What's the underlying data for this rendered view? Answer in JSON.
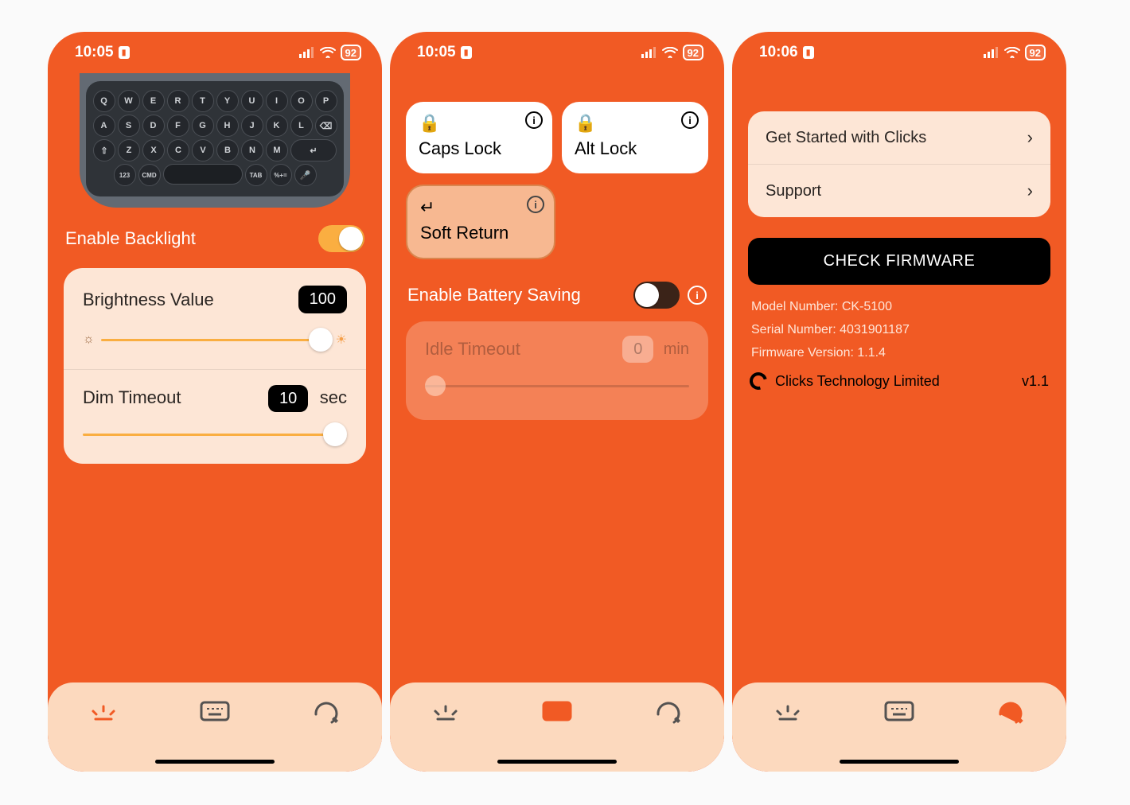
{
  "status": {
    "times": [
      "10:05",
      "10:05",
      "10:06"
    ],
    "battery": "92"
  },
  "screen1": {
    "backlight_label": "Enable Backlight",
    "brightness_label": "Brightness Value",
    "brightness_value": "100",
    "dim_timeout_label": "Dim Timeout",
    "dim_timeout_value": "10",
    "dim_timeout_unit": "sec",
    "keyboard_rows": [
      [
        "Q",
        "W",
        "E",
        "R",
        "T",
        "Y",
        "U",
        "I",
        "O",
        "P"
      ],
      [
        "A",
        "S",
        "D",
        "F",
        "G",
        "H",
        "J",
        "K",
        "L",
        "⌫"
      ],
      [
        "⇧",
        "Z",
        "X",
        "C",
        "V",
        "B",
        "N",
        "M",
        "↵"
      ],
      [
        "123",
        "CMD",
        "SPACE",
        "TAB",
        "%+=",
        "🎤"
      ]
    ]
  },
  "screen2": {
    "cards": [
      {
        "title": "Caps Lock",
        "icon": "lock-caps"
      },
      {
        "title": "Alt Lock",
        "icon": "lock-alt"
      },
      {
        "title": "Soft Return",
        "icon": "return"
      }
    ],
    "battery_label": "Enable Battery Saving",
    "idle_label": "Idle Timeout",
    "idle_value": "0",
    "idle_unit": "min"
  },
  "screen3": {
    "list": [
      "Get Started with Clicks",
      "Support"
    ],
    "firmware_btn": "CHECK FIRMWARE",
    "info_lines": [
      "Model Number: CK-5100",
      "Serial Number: 4031901187",
      "Firmware Version: 1.1.4"
    ],
    "company": "Clicks Technology Limited",
    "version": "v1.1"
  },
  "tabs": [
    "backlight-icon",
    "keyboard-icon",
    "settings-icon"
  ]
}
